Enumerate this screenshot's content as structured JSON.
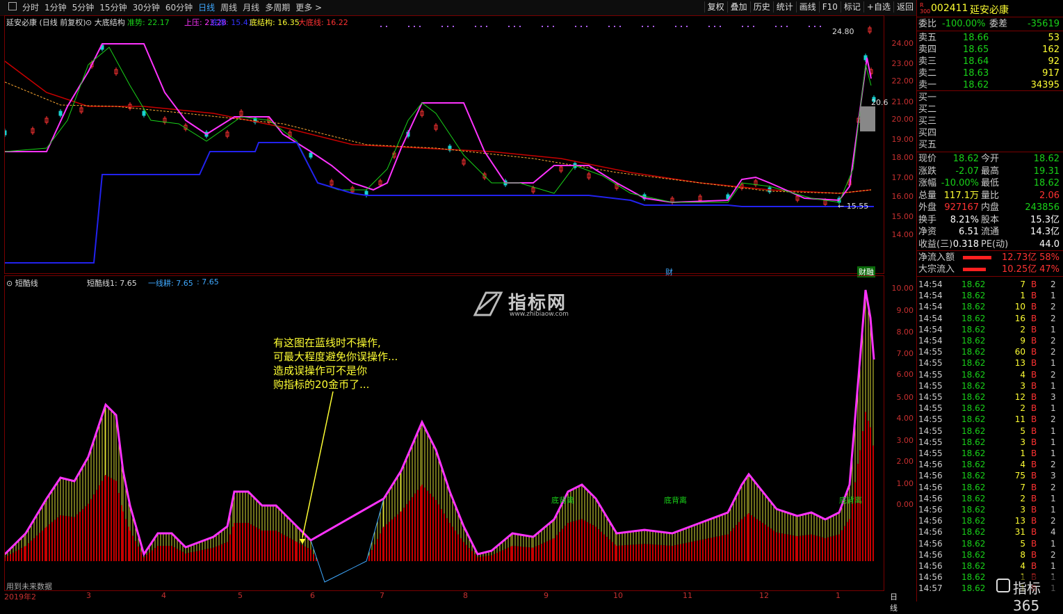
{
  "toolbar": {
    "tabs": [
      "分时",
      "1分钟",
      "5分钟",
      "15分钟",
      "30分钟",
      "60分钟",
      "日线",
      "周线",
      "月线",
      "多周期",
      "更多 >"
    ],
    "active_tab": "日线",
    "buttons": [
      "复权",
      "叠加",
      "历史",
      "统计",
      "画线",
      "F10",
      "标记",
      "+自选",
      "返回"
    ]
  },
  "price_panel": {
    "title": "延安必康 (日线 前复权)",
    "indicator_name": "大底结构",
    "legend": [
      {
        "label": "准势: 22.17",
        "color": "#19d219"
      },
      {
        "label": "上压: 23.28",
        "color": "#ff33ff"
      },
      {
        "label": "底撑: 15.41",
        "color": "#3333ff"
      },
      {
        "label": "底结构: 16.35",
        "color": "#ffff33"
      },
      {
        "label": "大底线: 16.22",
        "color": "#ff3232"
      }
    ],
    "y_ticks": [
      "24.00",
      "23.00",
      "22.00",
      "21.00",
      "20.00",
      "19.00",
      "18.00",
      "17.00",
      "16.00",
      "15.00",
      "14.00"
    ],
    "high_label": "24.80",
    "low_label": "15.55",
    "side_label": "20.6",
    "event_labels": [
      "财",
      "财融"
    ]
  },
  "indicator_panel": {
    "name": "短酷线",
    "legend": [
      {
        "label": "短酷线1: 7.65",
        "color": "#dddddd"
      },
      {
        "label": "一线耕: 7.65",
        "color": "#3fa9ff"
      },
      {
        "label": ": 7.65",
        "color": "#3fa9ff"
      }
    ],
    "y_ticks": [
      "10.00",
      "9.00",
      "8.00",
      "7.00",
      "6.00",
      "5.00",
      "4.00",
      "3.00",
      "2.00",
      "1.00",
      "0.00"
    ],
    "annotation_lines": [
      "有这图在蓝线时不操作,",
      "可最大程度避免你误操作...",
      "造成误操作可不是你",
      "购指标的20金币了..."
    ],
    "labels": [
      "底背离",
      "底背离",
      "底背离"
    ],
    "footer_note": "用到未来数据",
    "watermark_text": "指标网",
    "watermark_url": "www.zhibiaow.com"
  },
  "date_axis": {
    "labels": [
      "2019年2",
      "3",
      "4",
      "5",
      "6",
      "7",
      "8",
      "9",
      "10",
      "11",
      "12",
      "1"
    ],
    "period": "日线"
  },
  "quote": {
    "code": "002411",
    "name": "延安必康",
    "badge": "R 300",
    "weibi_label": "委比",
    "weibi": "-100.00%",
    "weicha_label": "委差",
    "weicha": "-35619",
    "asks": [
      {
        "label": "卖五",
        "price": "18.66",
        "vol": "53"
      },
      {
        "label": "卖四",
        "price": "18.65",
        "vol": "162"
      },
      {
        "label": "卖三",
        "price": "18.64",
        "vol": "92"
      },
      {
        "label": "卖二",
        "price": "18.63",
        "vol": "917"
      },
      {
        "label": "卖一",
        "price": "18.62",
        "vol": "34395"
      }
    ],
    "bids": [
      "买一",
      "买二",
      "买三",
      "买四",
      "买五"
    ],
    "stats": [
      {
        "k1": "现价",
        "v1": "18.62",
        "k2": "今开",
        "v2": "18.62",
        "c1": "green",
        "c2": "green"
      },
      {
        "k1": "涨跌",
        "v1": "-2.07",
        "k2": "最高",
        "v2": "19.31",
        "c1": "green",
        "c2": "green"
      },
      {
        "k1": "涨幅",
        "v1": "-10.00%",
        "k2": "最低",
        "v2": "18.62",
        "c1": "green",
        "c2": "green"
      },
      {
        "k1": "总量",
        "v1": "117.1万",
        "k2": "量比",
        "v2": "2.06",
        "c1": "yellow",
        "c2": "red"
      },
      {
        "k1": "外盘",
        "v1": "927167",
        "k2": "内盘",
        "v2": "243856",
        "c1": "red",
        "c2": "green"
      },
      {
        "k1": "换手",
        "v1": "8.21%",
        "k2": "股本",
        "v2": "15.3亿",
        "c1": "white",
        "c2": "white"
      },
      {
        "k1": "净资",
        "v1": "6.51",
        "k2": "流通",
        "v2": "14.3亿",
        "c1": "white",
        "c2": "white"
      },
      {
        "k1": "收益(三)",
        "v1": "0.318",
        "k2": "PE(动)",
        "v2": "44.0",
        "c1": "white",
        "c2": "white"
      }
    ],
    "flows": [
      {
        "label": "净流入额",
        "value": "12.73亿",
        "pct": "58%",
        "fill": 0.58
      },
      {
        "label": "大宗流入",
        "value": "10.25亿",
        "pct": "47%",
        "fill": 0.47
      }
    ],
    "ticks": [
      [
        "14:54",
        "18.62",
        "7",
        "B",
        "2"
      ],
      [
        "14:54",
        "18.62",
        "1",
        "B",
        "1"
      ],
      [
        "14:54",
        "18.62",
        "10",
        "B",
        "2"
      ],
      [
        "14:54",
        "18.62",
        "16",
        "B",
        "2"
      ],
      [
        "14:54",
        "18.62",
        "2",
        "B",
        "1"
      ],
      [
        "14:54",
        "18.62",
        "9",
        "B",
        "2"
      ],
      [
        "14:55",
        "18.62",
        "60",
        "B",
        "2"
      ],
      [
        "14:55",
        "18.62",
        "13",
        "B",
        "1"
      ],
      [
        "14:55",
        "18.62",
        "4",
        "B",
        "2"
      ],
      [
        "14:55",
        "18.62",
        "3",
        "B",
        "1"
      ],
      [
        "14:55",
        "18.62",
        "12",
        "B",
        "3"
      ],
      [
        "14:55",
        "18.62",
        "2",
        "B",
        "1"
      ],
      [
        "14:55",
        "18.62",
        "11",
        "B",
        "2"
      ],
      [
        "14:55",
        "18.62",
        "5",
        "B",
        "1"
      ],
      [
        "14:55",
        "18.62",
        "3",
        "B",
        "1"
      ],
      [
        "14:55",
        "18.62",
        "1",
        "B",
        "1"
      ],
      [
        "14:56",
        "18.62",
        "4",
        "B",
        "2"
      ],
      [
        "14:56",
        "18.62",
        "75",
        "B",
        "3"
      ],
      [
        "14:56",
        "18.62",
        "7",
        "B",
        "2"
      ],
      [
        "14:56",
        "18.62",
        "2",
        "B",
        "1"
      ],
      [
        "14:56",
        "18.62",
        "3",
        "B",
        "1"
      ],
      [
        "14:56",
        "18.62",
        "13",
        "B",
        "2"
      ],
      [
        "14:56",
        "18.62",
        "31",
        "B",
        "4"
      ],
      [
        "14:56",
        "18.62",
        "5",
        "B",
        "1"
      ],
      [
        "14:56",
        "18.62",
        "8",
        "B",
        "2"
      ],
      [
        "14:56",
        "18.62",
        "4",
        "B",
        "1"
      ],
      [
        "14:56",
        "18.62",
        "1",
        "B",
        "1"
      ],
      [
        "14:57",
        "18.62",
        "1",
        "B",
        "1"
      ]
    ],
    "logo": "指标365"
  }
}
